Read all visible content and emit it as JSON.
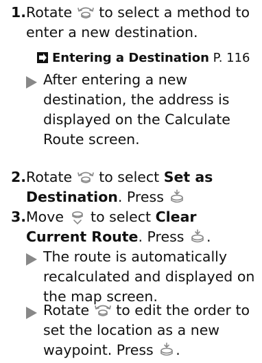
{
  "colors": {
    "text": "#111111",
    "icon": "#888888"
  },
  "icons": {
    "rotate": "interface-dial-rotate-icon",
    "move": "interface-dial-move-icon",
    "press": "interface-dial-press-icon",
    "reference": "reference-arrow-icon",
    "bullet": "triangle-bullet-icon"
  },
  "steps": [
    {
      "num": "1.",
      "prefix": "Rotate",
      "text": "to select a method to enter a new destination.",
      "reference": {
        "label": "Entering a Destination",
        "page": "P. 116"
      },
      "note": "After entering a new destination, the address is displayed on the Calculate Route screen."
    },
    {
      "num": "2.",
      "prefix": "Rotate",
      "text_a": "to select",
      "bold": "Set as Destination",
      "text_b": ". Press"
    },
    {
      "num": "3.",
      "prefix": "Move",
      "text_a": "to select",
      "bold": "Clear Current Route",
      "text_b": ". Press",
      "end": ".",
      "notes": [
        {
          "text": "The route is automatically recalculated and displayed on the map screen."
        },
        {
          "prefix": "Rotate",
          "text_a": "to edit the order to set the location as a new waypoint. Press",
          "text_b": "."
        }
      ]
    }
  ]
}
